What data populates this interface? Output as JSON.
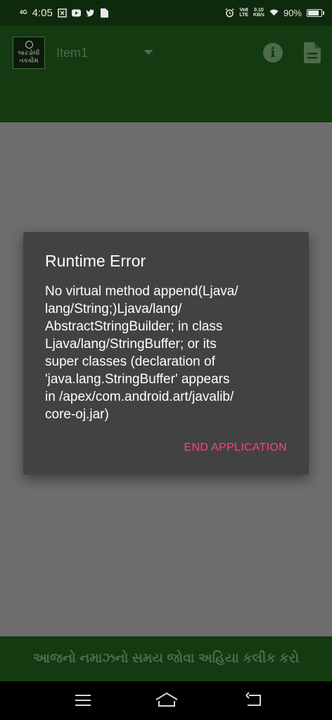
{
  "status_bar": {
    "network": "4G",
    "time": "4:05",
    "volte": "Vo8\nLTE",
    "speed": "0.10\nKB/s",
    "battery_percent": "90%",
    "battery_level": 0.9
  },
  "toolbar": {
    "logo_line1": "બારડોલી",
    "logo_line2": "તકવીમ",
    "spinner_value": "Item1",
    "icons": [
      "info-icon",
      "document-icon"
    ]
  },
  "dialog": {
    "title": "Runtime Error",
    "message": "No virtual method append(Ljava/\nlang/String;)Ljava/lang/\nAbstractStringBuilder; in class\nLjava/lang/StringBuffer; or its\nsuper classes (declaration of\n'java.lang.StringBuffer' appears\nin /apex/com.android.art/javalib/\ncore-oj.jar)",
    "button": "END APPLICATION"
  },
  "banner": {
    "text": "આજનો નમાઝનો સમય જોવા અહિયા કલીક કરો"
  },
  "colors": {
    "toolbar": "#133a10",
    "dialog_bg": "#424242",
    "accent": "#ff4081",
    "scrim": "#6d6d6d"
  }
}
